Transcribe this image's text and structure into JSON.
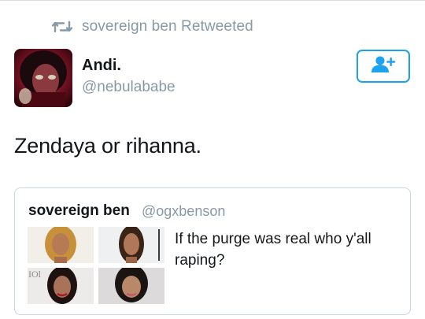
{
  "retweet": {
    "icon": "retweet-icon",
    "text": "sovereign ben Retweeted"
  },
  "author": {
    "display_name": "Andi.",
    "handle": "@nebulababe",
    "avatar": "avatar-photo"
  },
  "follow_button": {
    "icon": "add-user-icon",
    "color": "#1da1f2"
  },
  "tweet": {
    "text": "Zendaya or rihanna."
  },
  "quoted_tweet": {
    "author_name": "sovereign ben",
    "author_handle": "@ogxbenson",
    "text": "If the purge was real who y'all raping?",
    "media": [
      {
        "name": "photo-1",
        "overlay_text": ""
      },
      {
        "name": "photo-2",
        "overlay_text": ""
      },
      {
        "name": "photo-3",
        "overlay_text": "IOl"
      },
      {
        "name": "photo-4",
        "overlay_text": ""
      }
    ]
  },
  "colors": {
    "text_primary": "#14171a",
    "text_secondary": "#8899a6",
    "accent": "#1da1f2",
    "border": "#ccd6dd"
  }
}
